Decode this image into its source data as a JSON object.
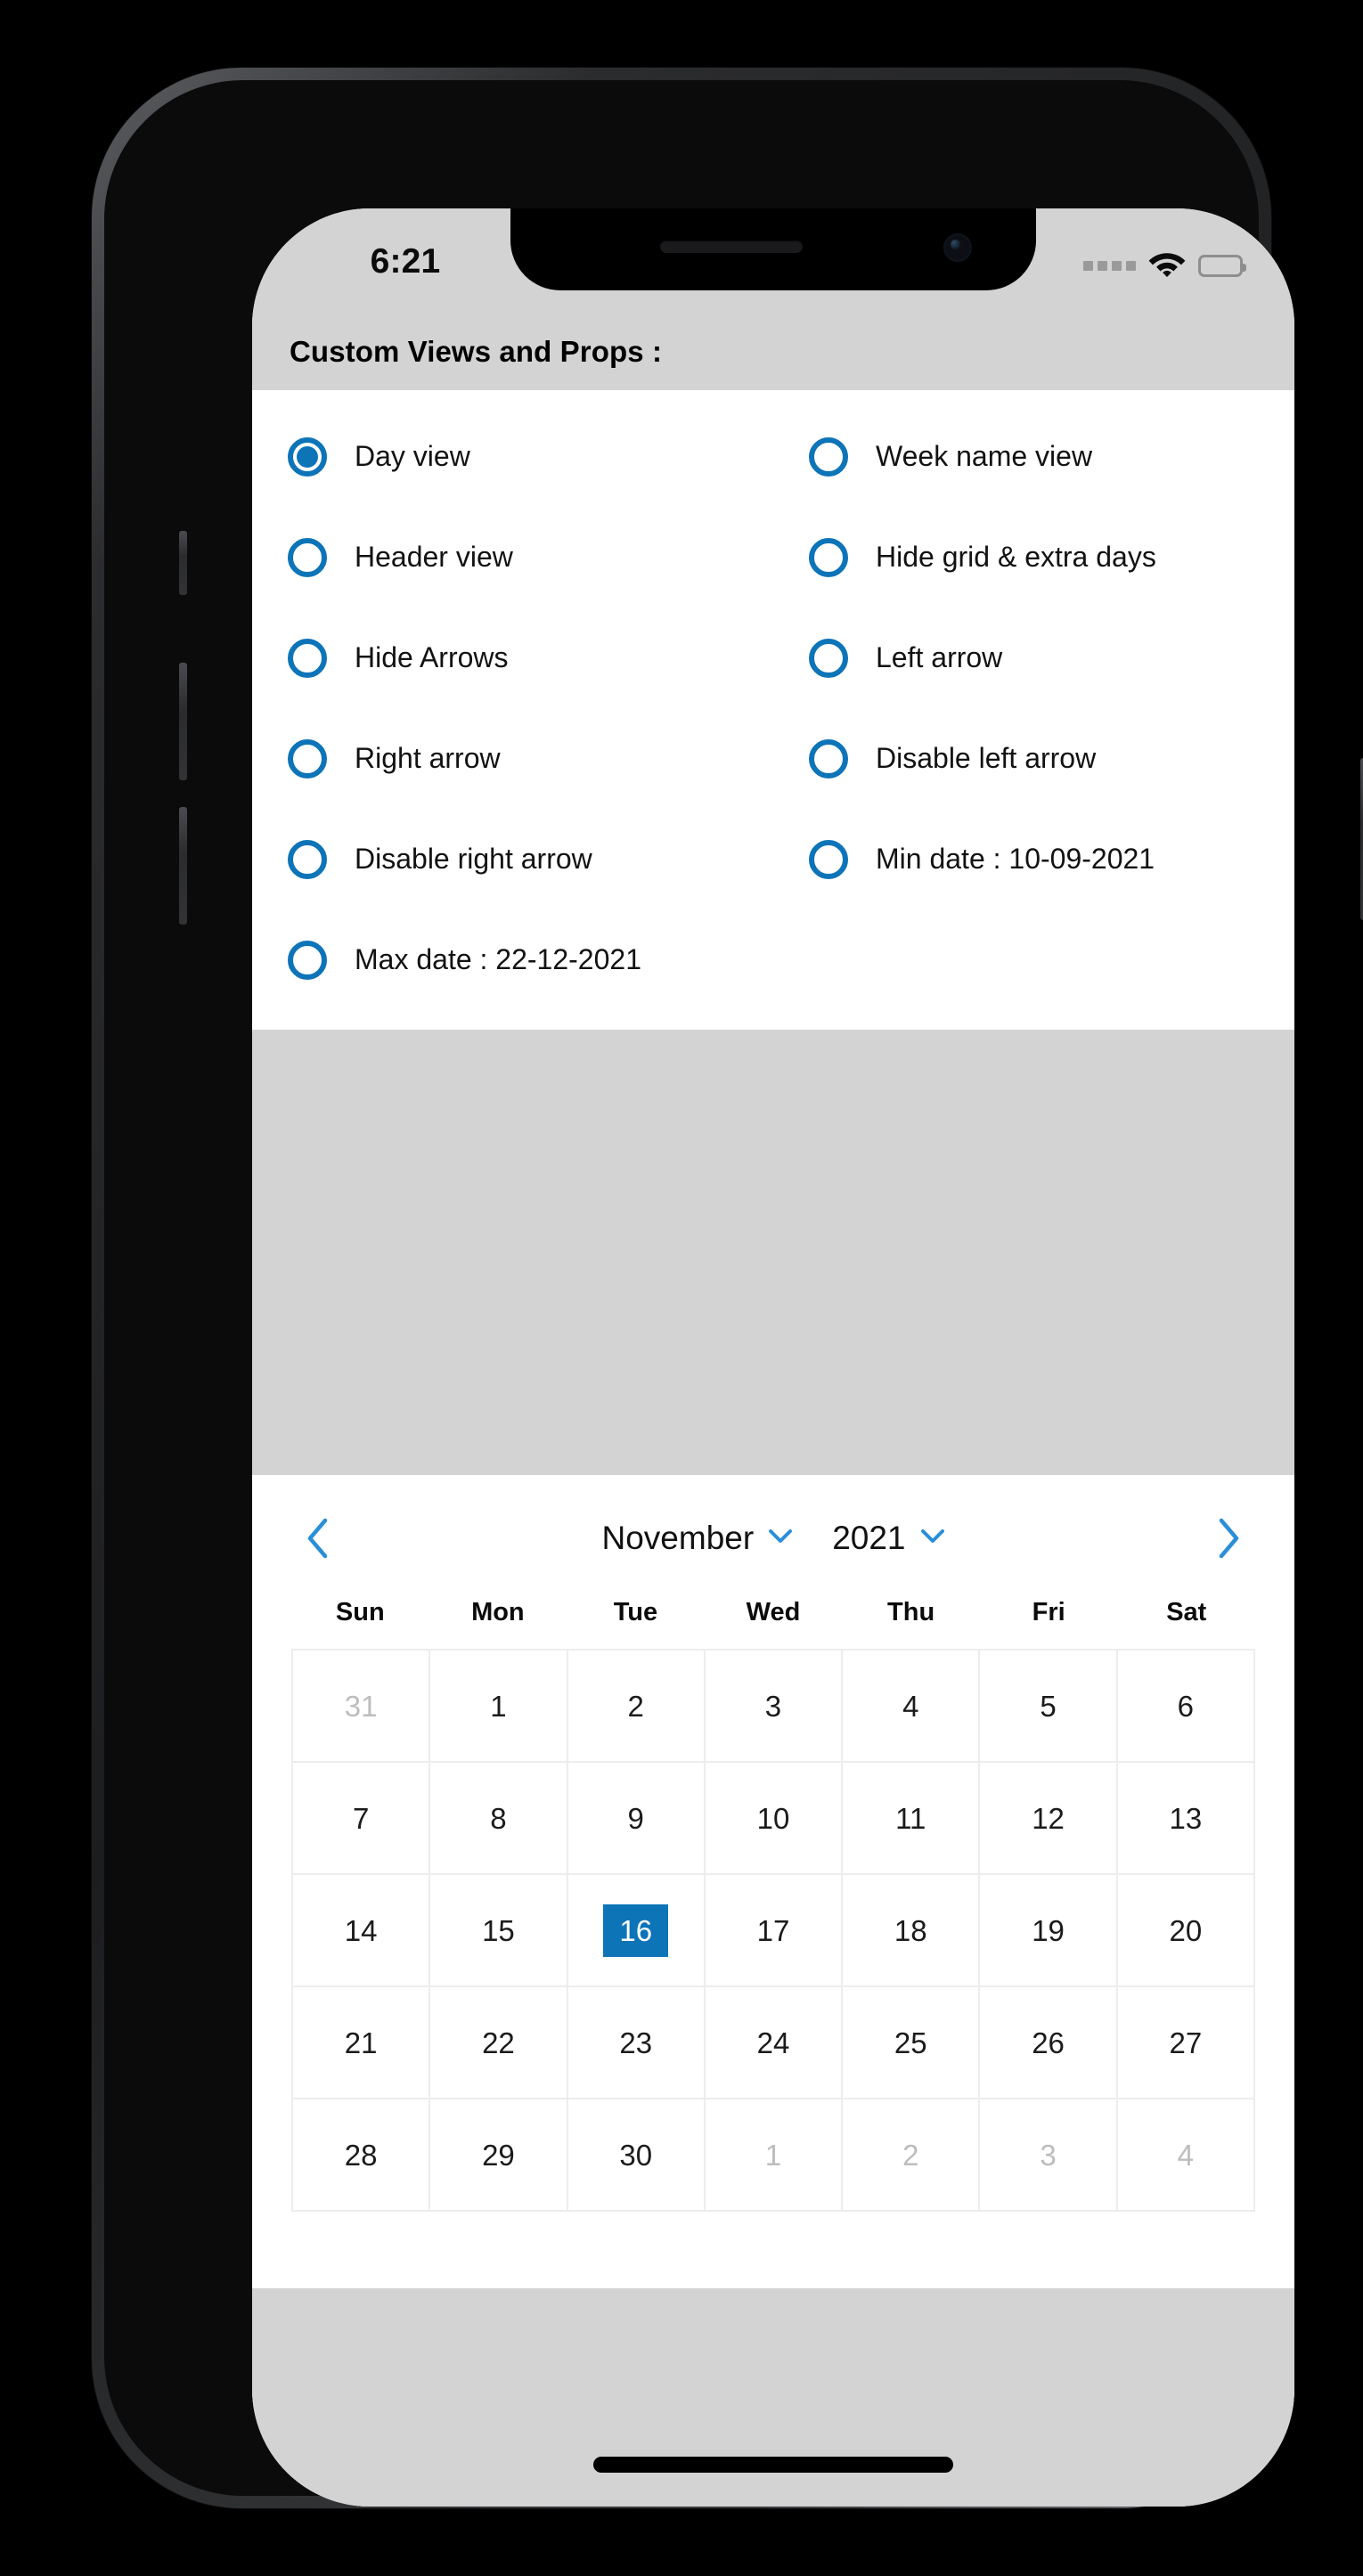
{
  "device": {
    "status_bar": {
      "time": "6:21",
      "cellular_icon": "cellular-dots-icon",
      "wifi_icon": "wifi-icon",
      "battery_icon": "battery-full-icon"
    },
    "home_indicator": "home-indicator"
  },
  "colors": {
    "accent": "#0d74b8",
    "page_background": "#d3d3d3",
    "panel_background": "#ffffff",
    "grid_line": "#eceded",
    "muted_day": "#bdbdbd"
  },
  "header": {
    "title": "Custom Views and Props :"
  },
  "options": [
    {
      "label": "Day view",
      "selected": true
    },
    {
      "label": "Week name view",
      "selected": false
    },
    {
      "label": "Header view",
      "selected": false
    },
    {
      "label": "Hide grid & extra days",
      "selected": false
    },
    {
      "label": "Hide Arrows",
      "selected": false
    },
    {
      "label": "Left arrow",
      "selected": false
    },
    {
      "label": "Right arrow",
      "selected": false
    },
    {
      "label": "Disable left arrow",
      "selected": false
    },
    {
      "label": "Disable right arrow",
      "selected": false
    },
    {
      "label": "Min date : 10-09-2021",
      "selected": false
    },
    {
      "label": "Max date : 22-12-2021",
      "selected": false
    }
  ],
  "calendar": {
    "prev_icon": "chevron-left-icon",
    "next_icon": "chevron-right-icon",
    "month": "November",
    "month_dropdown_icon": "chevron-down-icon",
    "year": "2021",
    "year_dropdown_icon": "chevron-down-icon",
    "weekdays": [
      "Sun",
      "Mon",
      "Tue",
      "Wed",
      "Thu",
      "Fri",
      "Sat"
    ],
    "selected_day": "16",
    "weeks": [
      [
        {
          "day": "31",
          "muted": true,
          "selected": false
        },
        {
          "day": "1",
          "muted": false,
          "selected": false
        },
        {
          "day": "2",
          "muted": false,
          "selected": false
        },
        {
          "day": "3",
          "muted": false,
          "selected": false
        },
        {
          "day": "4",
          "muted": false,
          "selected": false
        },
        {
          "day": "5",
          "muted": false,
          "selected": false
        },
        {
          "day": "6",
          "muted": false,
          "selected": false
        }
      ],
      [
        {
          "day": "7",
          "muted": false,
          "selected": false
        },
        {
          "day": "8",
          "muted": false,
          "selected": false
        },
        {
          "day": "9",
          "muted": false,
          "selected": false
        },
        {
          "day": "10",
          "muted": false,
          "selected": false
        },
        {
          "day": "11",
          "muted": false,
          "selected": false
        },
        {
          "day": "12",
          "muted": false,
          "selected": false
        },
        {
          "day": "13",
          "muted": false,
          "selected": false
        }
      ],
      [
        {
          "day": "14",
          "muted": false,
          "selected": false
        },
        {
          "day": "15",
          "muted": false,
          "selected": false
        },
        {
          "day": "16",
          "muted": false,
          "selected": true
        },
        {
          "day": "17",
          "muted": false,
          "selected": false
        },
        {
          "day": "18",
          "muted": false,
          "selected": false
        },
        {
          "day": "19",
          "muted": false,
          "selected": false
        },
        {
          "day": "20",
          "muted": false,
          "selected": false
        }
      ],
      [
        {
          "day": "21",
          "muted": false,
          "selected": false
        },
        {
          "day": "22",
          "muted": false,
          "selected": false
        },
        {
          "day": "23",
          "muted": false,
          "selected": false
        },
        {
          "day": "24",
          "muted": false,
          "selected": false
        },
        {
          "day": "25",
          "muted": false,
          "selected": false
        },
        {
          "day": "26",
          "muted": false,
          "selected": false
        },
        {
          "day": "27",
          "muted": false,
          "selected": false
        }
      ],
      [
        {
          "day": "28",
          "muted": false,
          "selected": false
        },
        {
          "day": "29",
          "muted": false,
          "selected": false
        },
        {
          "day": "30",
          "muted": false,
          "selected": false
        },
        {
          "day": "1",
          "muted": true,
          "selected": false
        },
        {
          "day": "2",
          "muted": true,
          "selected": false
        },
        {
          "day": "3",
          "muted": true,
          "selected": false
        },
        {
          "day": "4",
          "muted": true,
          "selected": false
        }
      ]
    ]
  }
}
